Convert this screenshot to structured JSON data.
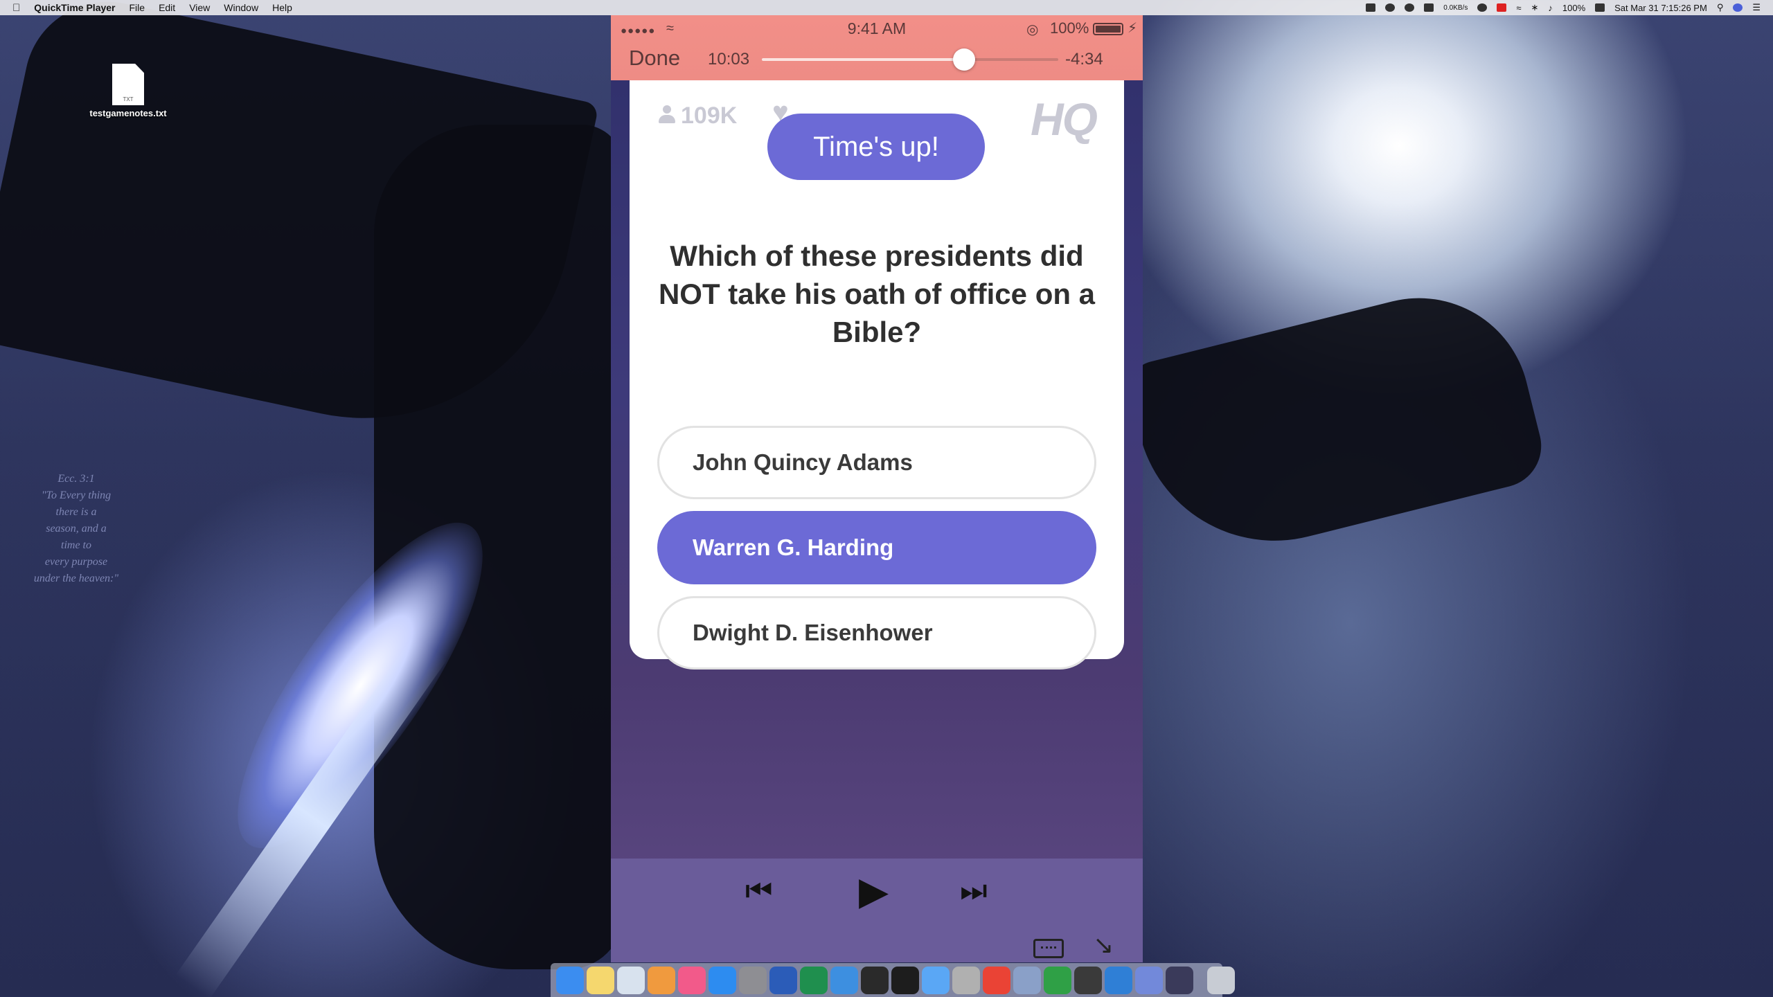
{
  "menubar": {
    "app_name": "QuickTime Player",
    "menus": [
      "File",
      "Edit",
      "View",
      "Window",
      "Help"
    ],
    "network_speed": "0.0KB/s",
    "battery": "100%",
    "datetime": "Sat Mar 31  7:15:26 PM"
  },
  "desktop": {
    "file_name": "testgamenotes.txt",
    "file_ext": "TXT",
    "quote_ref": "Ecc. 3:1",
    "quote_lines": [
      "\"To Every thing",
      "there is a",
      "season, and a",
      "time to",
      "every purpose",
      "under the heaven:\""
    ]
  },
  "phone_status": {
    "time": "9:41 AM",
    "battery": "100%"
  },
  "player": {
    "done_label": "Done",
    "elapsed": "10:03",
    "remaining": "-4:34",
    "progress": 0.683
  },
  "game": {
    "viewers": "109K",
    "logo": "HQ",
    "timer_text": "Time's up!",
    "question": "Which of these presidents did NOT take his oath of office on a Bible?",
    "answers": [
      {
        "label": "John Quincy Adams",
        "selected": false
      },
      {
        "label": "Warren G. Harding",
        "selected": true
      },
      {
        "label": "Dwight D. Eisenhower",
        "selected": false
      }
    ]
  },
  "colors": {
    "accent_purple": "#6c6ad6",
    "player_bar": "#ee8c85"
  },
  "dock": {
    "apps": [
      "Finder",
      "Notes",
      "Preview",
      "Photos",
      "iTunes",
      "App Store",
      "System Preferences",
      "Word",
      "Excel",
      "Xcode",
      "Go",
      "Terminal",
      "Messages",
      "Image Capture",
      "Chrome",
      "VirtualBox",
      "Evernote",
      "Sublime",
      "Trello",
      "Discord",
      "QuickTime",
      "Trash"
    ]
  }
}
